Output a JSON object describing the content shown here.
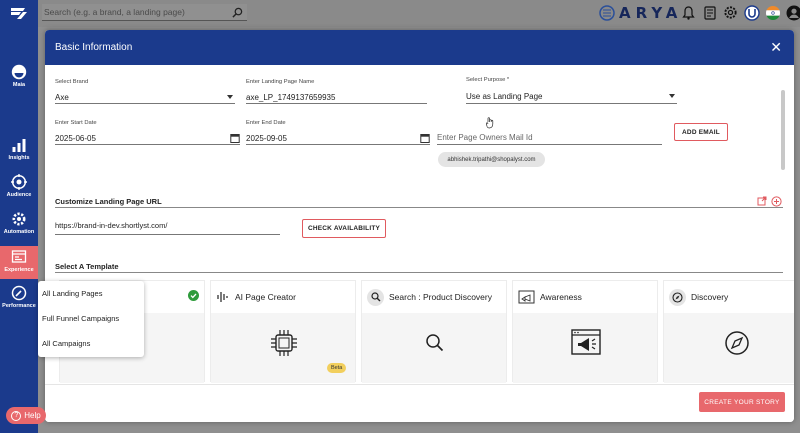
{
  "topbar": {
    "search_placeholder": "Search (e.g. a brand, a landing page)",
    "brand": "ARYA"
  },
  "nav": {
    "items": [
      {
        "label": "Maia",
        "icon": "maia-icon"
      },
      {
        "label": "Insights",
        "icon": "bar-chart-icon"
      },
      {
        "label": "Audience",
        "icon": "target-icon"
      },
      {
        "label": "Automation",
        "icon": "gear-icon"
      },
      {
        "label": "Experience",
        "icon": "browser-icon",
        "active": true
      },
      {
        "label": "Performance",
        "icon": "gauge-icon"
      }
    ],
    "help_label": "Help"
  },
  "menu": {
    "items": [
      "All Landing Pages",
      "Full Funnel Campaigns",
      "All Campaigns"
    ]
  },
  "modal": {
    "title": "Basic Information",
    "brand": {
      "label": "Select Brand",
      "value": "Axe"
    },
    "lp_name": {
      "label": "Enter Landing Page Name",
      "value": "axe_LP_1749137659935"
    },
    "purpose": {
      "label": "Select Purpose *",
      "value": "Use as Landing Page"
    },
    "start_date": {
      "label": "Enter Start Date",
      "value": "2025-06-05"
    },
    "end_date": {
      "label": "Enter End Date",
      "value": "2025-09-05"
    },
    "owner_mail": {
      "placeholder": "Enter Page Owners Mail Id"
    },
    "add_email": "ADD EMAIL",
    "email_chip": "abhishek.tripathi@shopalyst.com",
    "url_section_title": "Customize Landing Page URL",
    "url_value": "https://brand-in-dev.shortlyst.com/",
    "check_availability": "CHECK AVAILABILITY",
    "template_section_title": "Select A Template",
    "templates": [
      {
        "title": "",
        "icon": "document-icon",
        "selected": true
      },
      {
        "title": "AI Page Creator",
        "icon": "chip-icon",
        "badge": "Beta"
      },
      {
        "title": "Search : Product Discovery",
        "icon": "search-icon"
      },
      {
        "title": "Awareness",
        "icon": "megaphone-icon"
      },
      {
        "title": "Discovery",
        "icon": "compass-icon"
      }
    ],
    "create_button": "CREATE YOUR STORY"
  },
  "colors": {
    "nav_bg": "#1b3a8c",
    "accent": "#e8686c",
    "modal_header": "#1b3a8c"
  }
}
